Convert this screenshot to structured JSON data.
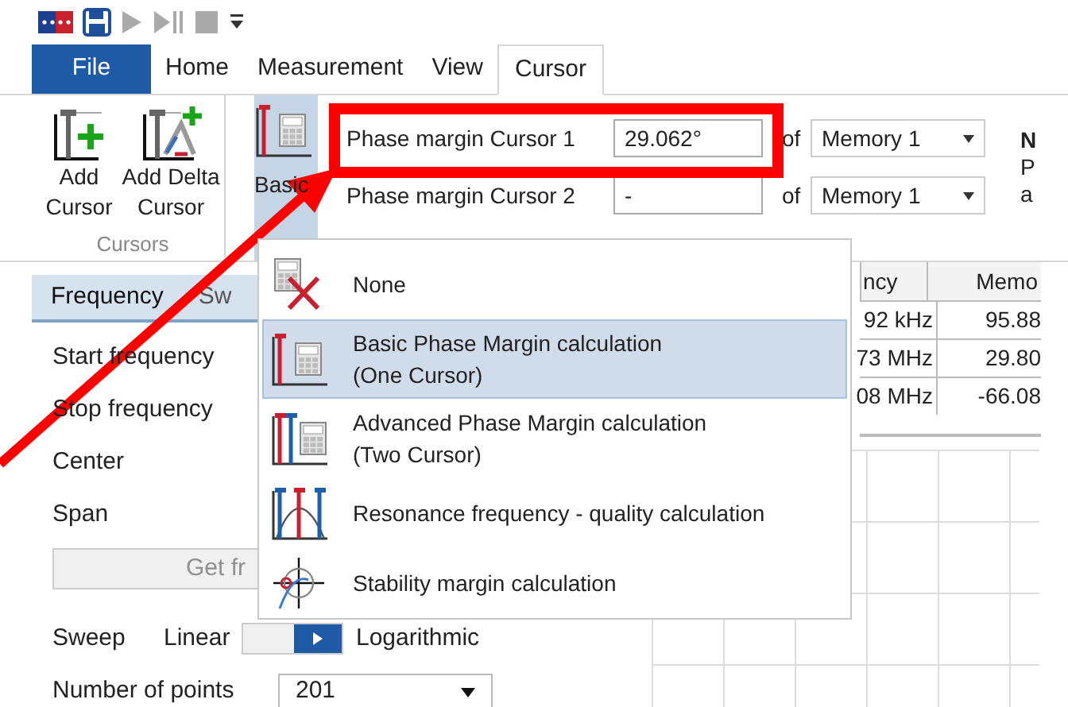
{
  "menu_tabs": [
    {
      "label": "File",
      "kind": "file",
      "selected": false
    },
    {
      "label": "Home",
      "kind": "tab",
      "selected": false
    },
    {
      "label": "Measurement",
      "kind": "tab",
      "selected": false
    },
    {
      "label": "View",
      "kind": "tab",
      "selected": false
    },
    {
      "label": "Cursor",
      "kind": "tab",
      "selected": true
    }
  ],
  "ribbon": {
    "buttons": [
      {
        "kind": "add",
        "lines": [
          "Add",
          "Cursor"
        ]
      },
      {
        "kind": "delta",
        "lines": [
          "Add Delta",
          "Cursor"
        ]
      }
    ],
    "group_label": "Cursors",
    "basic_button": {
      "label": "Basic",
      "selected": true
    },
    "phase_rows": [
      {
        "label": "Phase margin Cursor 1",
        "value": "29.062°",
        "of": "of",
        "memory": "Memory 1"
      },
      {
        "label": "Phase margin Cursor 2",
        "value": "-",
        "of": "of",
        "memory": "Memory 1"
      }
    ],
    "side_texts": [
      "N",
      "P",
      "a"
    ]
  },
  "left_panel": {
    "tabs": [
      {
        "label": "Frequency",
        "selected": true
      },
      {
        "label": "Sw",
        "selected": false
      }
    ],
    "fields": [
      "Start frequency",
      "Stop frequency",
      "Center",
      "Span"
    ],
    "button": "Get fr",
    "sweep": {
      "label": "Sweep",
      "left": "Linear",
      "right": "Logarithmic",
      "on": true
    },
    "points": {
      "label": "Number of points",
      "value": "201"
    }
  },
  "dropdown_menu": {
    "items": [
      {
        "kind": "none",
        "lines": [
          "None"
        ],
        "selected": false
      },
      {
        "kind": "basic",
        "lines": [
          "Basic Phase Margin calculation",
          "(One Cursor)"
        ],
        "selected": true
      },
      {
        "kind": "advanced",
        "lines": [
          "Advanced Phase Margin calculation",
          "(Two Cursor)"
        ],
        "selected": false
      },
      {
        "kind": "resonance",
        "lines": [
          "Resonance frequency - quality calculation"
        ],
        "selected": false
      },
      {
        "kind": "stability",
        "lines": [
          "Stability margin calculation"
        ],
        "selected": false
      }
    ]
  },
  "table": {
    "columns": [
      "ncy",
      "Memo"
    ],
    "rows": [
      [
        "92 kHz",
        "95.88"
      ],
      [
        "73 MHz",
        "29.80"
      ],
      [
        "08 MHz",
        "-66.08"
      ]
    ]
  }
}
